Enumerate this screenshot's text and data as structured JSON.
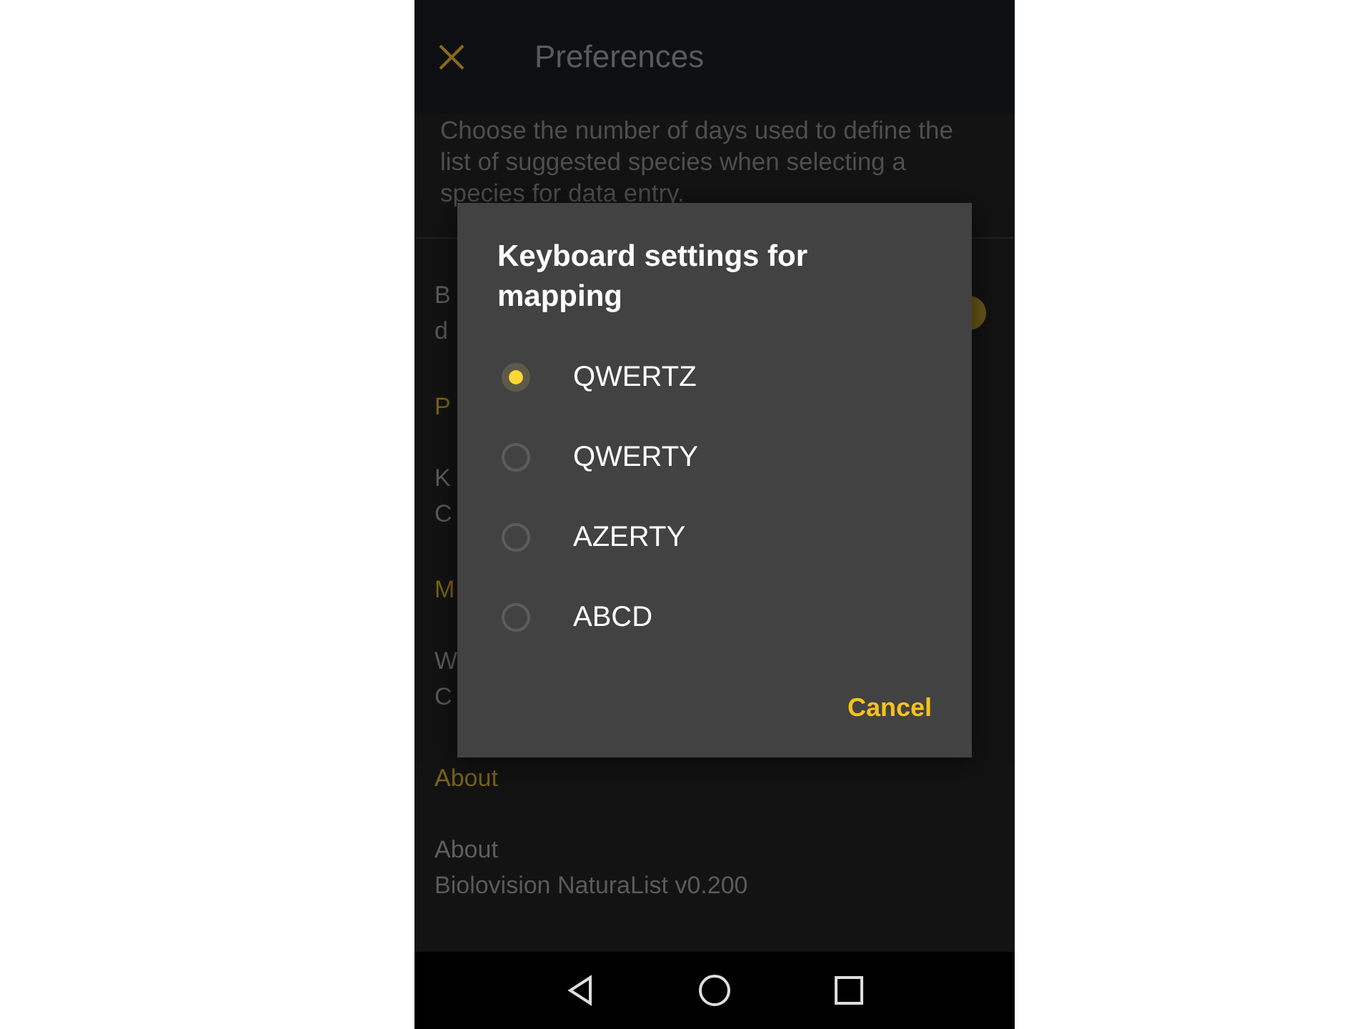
{
  "app_bar": {
    "title": "Preferences"
  },
  "description": "Choose the number of days used to define the list of suggested species when selecting a species for data entry.",
  "background_items": [
    {
      "kind": "setting",
      "title": "B",
      "subtitle": "d",
      "toggle": true
    },
    {
      "kind": "header",
      "title": "P"
    },
    {
      "kind": "setting",
      "title": "K",
      "subtitle": "C"
    },
    {
      "kind": "header",
      "title": "M"
    },
    {
      "kind": "setting",
      "title": "W",
      "subtitle": "C"
    },
    {
      "kind": "header",
      "title": "About"
    },
    {
      "kind": "setting",
      "title": "About",
      "subtitle": "Biolovision NaturaList v0.200"
    }
  ],
  "dialog": {
    "title": "Keyboard settings for mapping",
    "options": [
      {
        "label": "QWERTZ",
        "selected": true
      },
      {
        "label": "QWERTY",
        "selected": false
      },
      {
        "label": "AZERTY",
        "selected": false
      },
      {
        "label": "ABCD",
        "selected": false
      }
    ],
    "cancel": "Cancel"
  }
}
